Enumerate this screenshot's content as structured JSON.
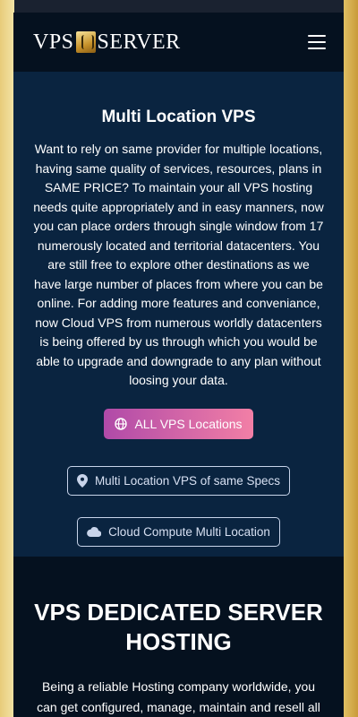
{
  "header": {
    "logo_left": "VPS",
    "logo_right": "SERVER",
    "menu_icon": "hamburger-icon"
  },
  "multi_location": {
    "title": "Multi Location VPS",
    "body": "Want to rely on same provider for multiple locations, having same quality of services, resources, plans in SAME PRICE? To maintain your all VPS hosting needs quite appropriately and in easy manners, now you can place orders through single window from 17 numerously located and territorial datacenters. You are still free to explore other destinations as we have large number of places from where you can be online. For adding more features and conveniance, now Cloud VPS from numerous worldly datacenters is being offered by us through which you would be able to upgrade and downgrade to any plan without loosing your data.",
    "btn_all": "ALL VPS Locations",
    "btn_same_specs": "Multi Location VPS of same Specs",
    "btn_cloud": "Cloud Compute Multi Location",
    "icons": [
      "globe-icon",
      "map-marker-icon",
      "cloud-icon"
    ]
  },
  "dedicated": {
    "title": "VPS DEDICATED SERVER HOSTING",
    "body": "Being a reliable Hosting company worldwide, you can get configured, manage, maintain and resell all kinds of"
  },
  "colors": {
    "page_bg": "#1a2230",
    "gold": "#e0bf63",
    "navy_section": "#0a2440",
    "dark_section": "#05111f",
    "primary_gradient_start": "#b04aa8",
    "primary_gradient_end": "#f27fa6"
  }
}
